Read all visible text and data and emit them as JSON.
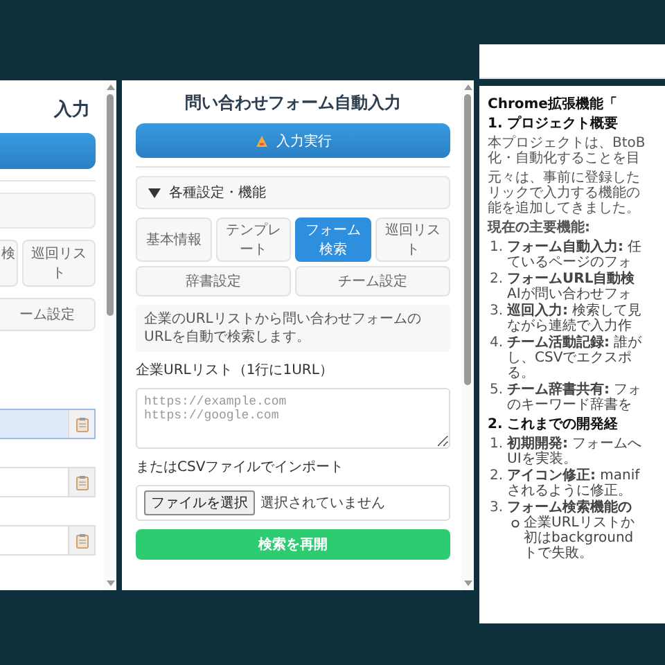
{
  "left_panel": {
    "title": "入力",
    "tabs": [
      {
        "label": "検",
        "selected": false
      },
      {
        "label": "巡回リスト",
        "selected": false
      },
      {
        "label": "ーム設定",
        "selected": false
      }
    ],
    "fields": [
      {
        "focused": true
      },
      {
        "focused": false
      },
      {
        "focused": false
      }
    ]
  },
  "main_panel": {
    "title": "問い合わせフォーム自動入力",
    "run_button": "入力実行",
    "section": {
      "label": "各種設定・機能",
      "expanded": true
    },
    "tabs": [
      {
        "label": "基本情報",
        "selected": false
      },
      {
        "label": "テンプレート",
        "selected": false
      },
      {
        "label": "フォーム検索",
        "selected": true
      },
      {
        "label": "巡回リスト",
        "selected": false
      },
      {
        "label": "辞書設定",
        "selected": false
      },
      {
        "label": "チーム設定",
        "selected": false
      }
    ],
    "info": "企業のURLリストから問い合わせフォームのURLを自動で検索します。",
    "url_list": {
      "label": "企業URLリスト（1行に1URL）",
      "placeholder": "https://example.com\nhttps://google.com"
    },
    "csv_import": {
      "label": "またはCSVファイルでインポート",
      "file_button": "ファイルを選択",
      "file_status": "選択されていません"
    },
    "resume_button": "検索を再開"
  },
  "document": {
    "blocks": [
      {
        "kind": "title",
        "text": "Chrome拡張機能「"
      },
      {
        "kind": "heading",
        "text": "1. プロジェクト概要"
      },
      {
        "kind": "paragraph",
        "lines": [
          "本プロジェクトは、BtoB",
          "化・自動化することを目"
        ]
      },
      {
        "kind": "paragraph",
        "lines": [
          "元々は、事前に登録した",
          "リックで入力する機能の",
          "能を追加してきました。"
        ]
      },
      {
        "kind": "paragraph",
        "lines": [
          "**現在の主要機能:**"
        ]
      },
      {
        "kind": "list",
        "items": [
          {
            "marker": "1.",
            "lines": [
              "**フォーム自動入力:** 任",
              "ているページのフォ"
            ]
          },
          {
            "marker": "2.",
            "lines": [
              "**フォームURL自動検**",
              "AIが問い合わせフォ"
            ]
          },
          {
            "marker": "3.",
            "lines": [
              "**巡回入力:** 検索して見",
              "ながら連続で入力作"
            ]
          },
          {
            "marker": "4.",
            "lines": [
              "**チーム活動記録:** 誰が",
              "し、CSVでエクスポ",
              "る。"
            ]
          },
          {
            "marker": "5.",
            "lines": [
              "**チーム辞書共有:** フォ",
              "のキーワード辞書を"
            ]
          }
        ]
      },
      {
        "kind": "heading",
        "text": "2. これまでの開発経"
      },
      {
        "kind": "list",
        "items": [
          {
            "marker": "1.",
            "lines": [
              "**初期開発:** フォームへ",
              "UIを実装。"
            ]
          },
          {
            "marker": "2.",
            "lines": [
              "**アイコン修正:** manif",
              "されるように修正。"
            ]
          },
          {
            "marker": "3.",
            "lines": [
              "**フォーム検索機能の**"
            ],
            "children": [
              {
                "lines": [
                  "企業URLリストか",
                  "初はbackground",
                  "トで失敗。"
                ]
              }
            ]
          }
        ]
      }
    ]
  }
}
